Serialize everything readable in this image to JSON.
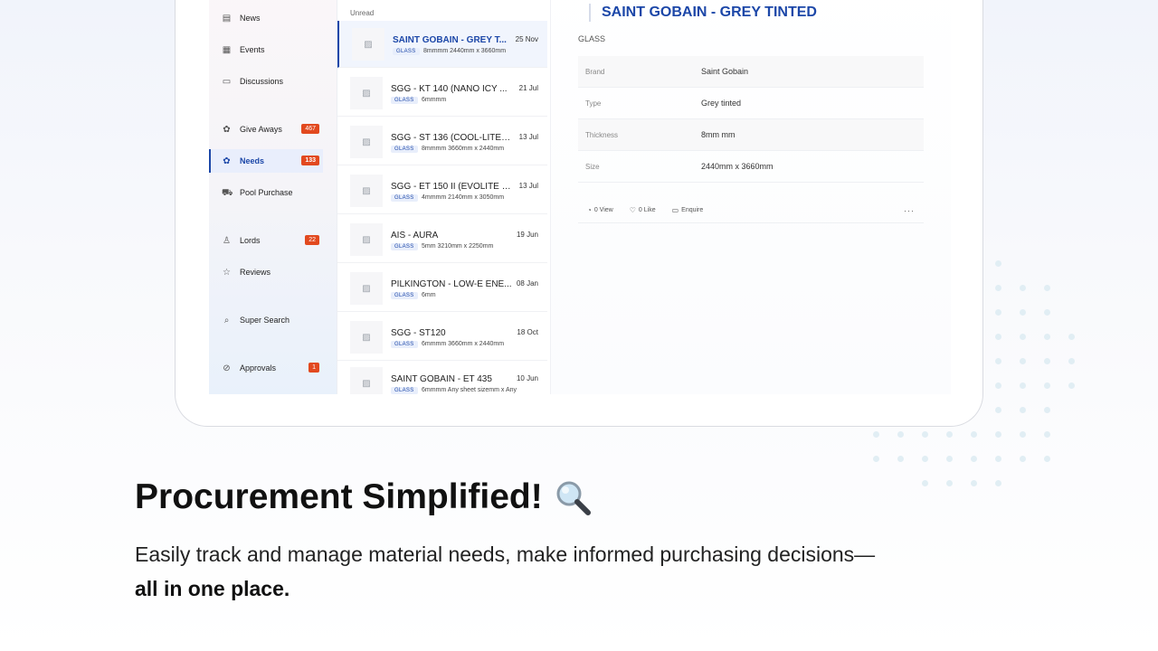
{
  "sidebar": {
    "items": [
      {
        "label": "News",
        "icon": "newspaper-icon",
        "badge": ""
      },
      {
        "label": "Events",
        "icon": "calendar-icon",
        "badge": ""
      },
      {
        "label": "Discussions",
        "icon": "chat-icon",
        "badge": ""
      },
      {
        "label": "Give Aways",
        "icon": "gift-icon",
        "badge": "467"
      },
      {
        "label": "Needs",
        "icon": "handshake-icon",
        "badge": "133",
        "active": true
      },
      {
        "label": "Pool Purchase",
        "icon": "truck-icon",
        "badge": ""
      },
      {
        "label": "Lords",
        "icon": "user-icon",
        "badge": "22"
      },
      {
        "label": "Reviews",
        "icon": "star-icon",
        "badge": ""
      },
      {
        "label": "Super Search",
        "icon": "search-icon",
        "badge": ""
      },
      {
        "label": "Approvals",
        "icon": "check-circle-icon",
        "badge": "1"
      }
    ]
  },
  "list": {
    "header": "Unread",
    "items": [
      {
        "title": "SAINT GOBAIN - GREY T...",
        "date": "25 Nov",
        "tag": "GLASS",
        "spec": "8mmmm 2440mm x 3660mm",
        "selected": true
      },
      {
        "title": "SGG - KT 140 (NANO ICY ...",
        "date": "21 Jul",
        "tag": "GLASS",
        "spec": "6mmmm"
      },
      {
        "title": "SGG - ST 136 (COOL-LITE G...",
        "date": "13 Jul",
        "tag": "GLASS",
        "spec": "8mmmm 3660mm x 2440mm"
      },
      {
        "title": "SGG - ET 150 II (EVOLITE C...",
        "date": "13 Jul",
        "tag": "GLASS",
        "spec": "4mmmm 2140mm x 3050mm"
      },
      {
        "title": "AIS - AURA",
        "date": "19 Jun",
        "tag": "GLASS",
        "spec": "5mm 3210mm x 2250mm"
      },
      {
        "title": "PILKINGTON - LOW-E ENE...",
        "date": "08 Jan",
        "tag": "GLASS",
        "spec": "6mm"
      },
      {
        "title": "SGG - ST120",
        "date": "18 Oct",
        "tag": "GLASS",
        "spec": "6mmmm 3660mm x 2440mm"
      },
      {
        "title": "SAINT GOBAIN - ET 435",
        "date": "10 Jun",
        "tag": "GLASS",
        "spec": "6mmmm Any sheet sizemm x Any"
      }
    ]
  },
  "detail": {
    "title": "SAINT GOBAIN - GREY TINTED",
    "category": "GLASS",
    "specs": [
      {
        "key": "Brand",
        "value": "Saint Gobain"
      },
      {
        "key": "Type",
        "value": "Grey tinted"
      },
      {
        "key": "Thickness",
        "value": "8mm mm"
      },
      {
        "key": "Size",
        "value": "2440mm x 3660mm"
      }
    ],
    "actions": {
      "view": "0 View",
      "like": "0 Like",
      "enquire": "Enquire",
      "more": "···"
    }
  },
  "marketing": {
    "headline": "Procurement Simplified!",
    "sub_text": "Easily track and manage material needs, make informed purchasing decisions—",
    "sub_bold": "all in one place."
  },
  "colors": {
    "accent": "#1c47a8",
    "badge": "#e2491f"
  }
}
